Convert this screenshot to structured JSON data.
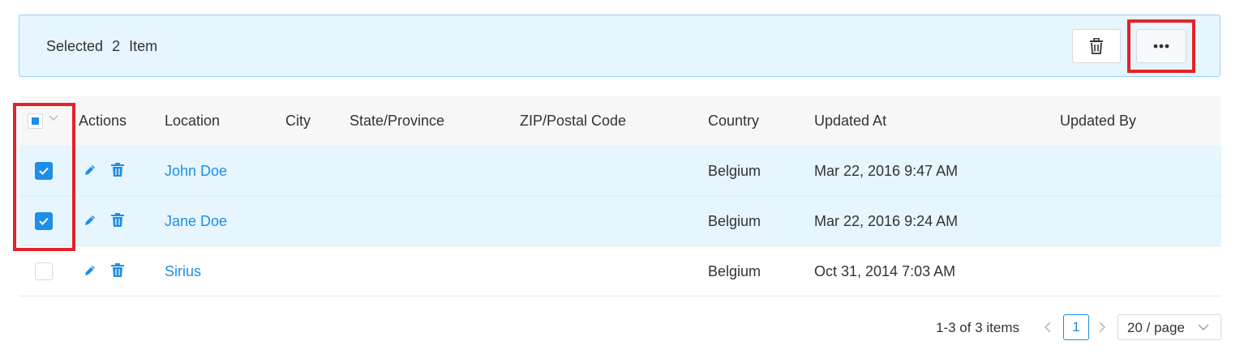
{
  "selection": {
    "prefix": "Selected",
    "count": "2",
    "suffix": "Item",
    "delete_icon": "trash-icon",
    "more_icon": "more-dots-icon"
  },
  "table": {
    "columns": [
      "Actions",
      "Location",
      "City",
      "State/Province",
      "ZIP/Postal Code",
      "Country",
      "Updated At",
      "Updated By"
    ],
    "rows": [
      {
        "checked": true,
        "location": "John Doe",
        "city": "",
        "state": "",
        "zip": "",
        "country": "Belgium",
        "updated_at": "Mar 22, 2016 9:47 AM",
        "updated_by": ""
      },
      {
        "checked": true,
        "location": "Jane Doe",
        "city": "",
        "state": "",
        "zip": "",
        "country": "Belgium",
        "updated_at": "Mar 22, 2016 9:24 AM",
        "updated_by": ""
      },
      {
        "checked": false,
        "location": "Sirius",
        "city": "",
        "state": "",
        "zip": "",
        "country": "Belgium",
        "updated_at": "Oct 31, 2014 7:03 AM",
        "updated_by": ""
      }
    ]
  },
  "pagination": {
    "summary": "1-3 of 3 items",
    "current_page": "1",
    "page_size": "20 / page"
  },
  "colors": {
    "accent": "#1e8ee6",
    "selected_row": "#e6f5fe",
    "highlight": "#e3232c"
  }
}
